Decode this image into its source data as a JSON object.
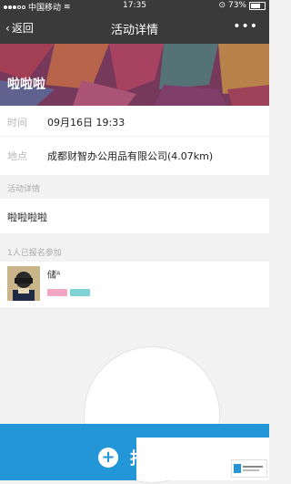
{
  "status_bar": {
    "carrier": "中国移动",
    "time": "17:35",
    "battery": "73%",
    "battery_level": 0.73
  },
  "nav": {
    "back_label": "返回",
    "title": "活动详情",
    "more_icon": "more-dots-icon"
  },
  "banner": {
    "title": "啦啦啦"
  },
  "info": {
    "time_label": "时间",
    "time_value": "09月16日 19:33",
    "place_label": "地点",
    "place_value": "成都财智办公用品有限公司(4.07km)"
  },
  "detail": {
    "section_title": "活动详情",
    "text": "啦啦啦啦"
  },
  "signup": {
    "section_title": "1人已报名参加",
    "members": [
      {
        "name": "储ᴬ"
      }
    ]
  },
  "action": {
    "icon": "plus-icon",
    "label": "报"
  },
  "colors": {
    "nav_bg": "#3a3a3a",
    "accent": "#2296d6",
    "tag_pink": "#f2a6c2",
    "tag_teal": "#7fd2d6"
  }
}
